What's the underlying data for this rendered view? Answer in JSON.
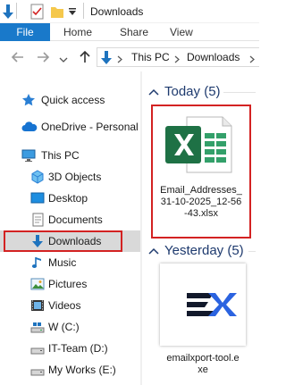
{
  "window": {
    "title": "Downloads"
  },
  "ribbon": {
    "tabs": [
      "File",
      "Home",
      "Share",
      "View"
    ]
  },
  "address": {
    "path": [
      "This PC",
      "Downloads"
    ]
  },
  "sidebar": {
    "items": [
      {
        "label": "Quick access",
        "icon": "star-icon"
      },
      {
        "label": "OneDrive - Personal",
        "icon": "cloud-icon"
      },
      {
        "label": "This PC",
        "icon": "computer-icon"
      },
      {
        "label": "3D Objects",
        "icon": "cube-icon"
      },
      {
        "label": "Desktop",
        "icon": "desktop-icon"
      },
      {
        "label": "Documents",
        "icon": "documents-icon"
      },
      {
        "label": "Downloads",
        "icon": "download-arrow-icon",
        "selected": true
      },
      {
        "label": "Music",
        "icon": "music-note-icon"
      },
      {
        "label": "Pictures",
        "icon": "pictures-icon"
      },
      {
        "label": "Videos",
        "icon": "videos-icon"
      },
      {
        "label": "W (C:)",
        "icon": "drive-icon"
      },
      {
        "label": "IT-Team (D:)",
        "icon": "drive-icon"
      },
      {
        "label": "My Works (E:)",
        "icon": "drive-icon"
      }
    ]
  },
  "groups": [
    {
      "title": "Today (5)",
      "files": [
        {
          "name_lines": [
            "Email_Addresses_",
            "31-10-2025_12-56",
            "-43.xlsx"
          ],
          "icon": "excel-file-icon"
        }
      ]
    },
    {
      "title": "Yesterday (5)",
      "files": [
        {
          "name_lines": [
            "emailxport-tool.e",
            "xe"
          ],
          "icon": "emailxport-app-icon"
        }
      ]
    }
  ],
  "colors": {
    "accent": "#1979ca",
    "highlight_outline": "#d32222",
    "excel_green": "#1e7145",
    "group_title": "#1e3a6e"
  }
}
